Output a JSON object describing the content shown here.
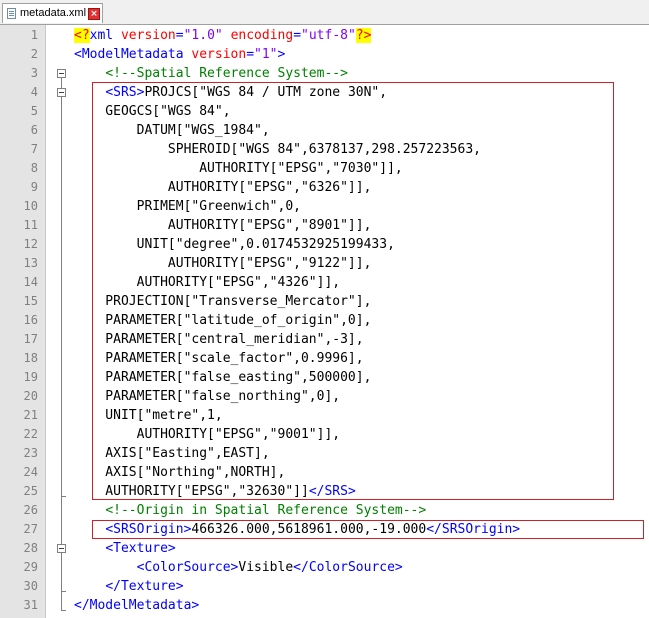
{
  "tab": {
    "title": "metadata.xml",
    "close_label": "×"
  },
  "lines": [
    {
      "n": "1",
      "tokens": [
        {
          "c": "pi-hl",
          "t": "<?"
        },
        {
          "c": "tag",
          "t": "xml"
        },
        {
          "c": "txt",
          "t": " "
        },
        {
          "c": "attr",
          "t": "version"
        },
        {
          "c": "tag",
          "t": "="
        },
        {
          "c": "val",
          "t": "\"1.0\""
        },
        {
          "c": "txt",
          "t": " "
        },
        {
          "c": "attr",
          "t": "encoding"
        },
        {
          "c": "tag",
          "t": "="
        },
        {
          "c": "val",
          "t": "\"utf-8\""
        },
        {
          "c": "pi-hl",
          "t": "?>"
        }
      ]
    },
    {
      "n": "2",
      "tokens": [
        {
          "c": "tag",
          "t": "<ModelMetadata"
        },
        {
          "c": "txt",
          "t": " "
        },
        {
          "c": "attr",
          "t": "version"
        },
        {
          "c": "tag",
          "t": "="
        },
        {
          "c": "val",
          "t": "\"1\""
        },
        {
          "c": "tag",
          "t": ">"
        }
      ]
    },
    {
      "n": "3",
      "tokens": [
        {
          "c": "txt",
          "t": "    "
        },
        {
          "c": "cmt",
          "t": "<!--Spatial Reference System-->"
        }
      ]
    },
    {
      "n": "4",
      "tokens": [
        {
          "c": "txt",
          "t": "    "
        },
        {
          "c": "tag",
          "t": "<SRS>"
        },
        {
          "c": "txt",
          "t": "PROJCS[\"WGS 84 / UTM zone 30N\","
        }
      ]
    },
    {
      "n": "5",
      "tokens": [
        {
          "c": "txt",
          "t": "    GEOGCS[\"WGS 84\","
        }
      ]
    },
    {
      "n": "6",
      "tokens": [
        {
          "c": "txt",
          "t": "        DATUM[\"WGS_1984\","
        }
      ]
    },
    {
      "n": "7",
      "tokens": [
        {
          "c": "txt",
          "t": "            SPHEROID[\"WGS 84\",6378137,298.257223563,"
        }
      ]
    },
    {
      "n": "8",
      "tokens": [
        {
          "c": "txt",
          "t": "                AUTHORITY[\"EPSG\",\"7030\"]],"
        }
      ]
    },
    {
      "n": "9",
      "tokens": [
        {
          "c": "txt",
          "t": "            AUTHORITY[\"EPSG\",\"6326\"]],"
        }
      ]
    },
    {
      "n": "10",
      "tokens": [
        {
          "c": "txt",
          "t": "        PRIMEM[\"Greenwich\",0,"
        }
      ]
    },
    {
      "n": "11",
      "tokens": [
        {
          "c": "txt",
          "t": "            AUTHORITY[\"EPSG\",\"8901\"]],"
        }
      ]
    },
    {
      "n": "12",
      "tokens": [
        {
          "c": "txt",
          "t": "        UNIT[\"degree\",0.0174532925199433,"
        }
      ]
    },
    {
      "n": "13",
      "tokens": [
        {
          "c": "txt",
          "t": "            AUTHORITY[\"EPSG\",\"9122\"]],"
        }
      ]
    },
    {
      "n": "14",
      "tokens": [
        {
          "c": "txt",
          "t": "        AUTHORITY[\"EPSG\",\"4326\"]],"
        }
      ]
    },
    {
      "n": "15",
      "tokens": [
        {
          "c": "txt",
          "t": "    PROJECTION[\"Transverse_Mercator\"],"
        }
      ]
    },
    {
      "n": "16",
      "tokens": [
        {
          "c": "txt",
          "t": "    PARAMETER[\"latitude_of_origin\",0],"
        }
      ]
    },
    {
      "n": "17",
      "tokens": [
        {
          "c": "txt",
          "t": "    PARAMETER[\"central_meridian\",-3],"
        }
      ]
    },
    {
      "n": "18",
      "tokens": [
        {
          "c": "txt",
          "t": "    PARAMETER[\"scale_factor\",0.9996],"
        }
      ]
    },
    {
      "n": "19",
      "tokens": [
        {
          "c": "txt",
          "t": "    PARAMETER[\"false_easting\",500000],"
        }
      ]
    },
    {
      "n": "20",
      "tokens": [
        {
          "c": "txt",
          "t": "    PARAMETER[\"false_northing\",0],"
        }
      ]
    },
    {
      "n": "21",
      "tokens": [
        {
          "c": "txt",
          "t": "    UNIT[\"metre\",1,"
        }
      ]
    },
    {
      "n": "22",
      "tokens": [
        {
          "c": "txt",
          "t": "        AUTHORITY[\"EPSG\",\"9001\"]],"
        }
      ]
    },
    {
      "n": "23",
      "tokens": [
        {
          "c": "txt",
          "t": "    AXIS[\"Easting\",EAST],"
        }
      ]
    },
    {
      "n": "24",
      "tokens": [
        {
          "c": "txt",
          "t": "    AXIS[\"Northing\",NORTH],"
        }
      ]
    },
    {
      "n": "25",
      "tokens": [
        {
          "c": "txt",
          "t": "    AUTHORITY[\"EPSG\",\"32630\"]]"
        },
        {
          "c": "tag",
          "t": "</SRS>"
        }
      ]
    },
    {
      "n": "26",
      "tokens": [
        {
          "c": "txt",
          "t": "    "
        },
        {
          "c": "cmt",
          "t": "<!--Origin in Spatial Reference System-->"
        }
      ]
    },
    {
      "n": "27",
      "tokens": [
        {
          "c": "txt",
          "t": "    "
        },
        {
          "c": "tag",
          "t": "<SRSOrigin>"
        },
        {
          "c": "txt",
          "t": "466326.000,5618961.000,-19.000"
        },
        {
          "c": "tag",
          "t": "</SRSOrigin>"
        }
      ]
    },
    {
      "n": "28",
      "tokens": [
        {
          "c": "txt",
          "t": "    "
        },
        {
          "c": "tag",
          "t": "<Texture>"
        }
      ]
    },
    {
      "n": "29",
      "tokens": [
        {
          "c": "txt",
          "t": "        "
        },
        {
          "c": "tag",
          "t": "<ColorSource>"
        },
        {
          "c": "txt",
          "t": "Visible"
        },
        {
          "c": "tag",
          "t": "</ColorSource>"
        }
      ]
    },
    {
      "n": "30",
      "tokens": [
        {
          "c": "txt",
          "t": "    "
        },
        {
          "c": "tag",
          "t": "</Texture>"
        }
      ]
    },
    {
      "n": "31",
      "tokens": [
        {
          "c": "tag",
          "t": "</ModelMetadata>"
        }
      ]
    }
  ]
}
